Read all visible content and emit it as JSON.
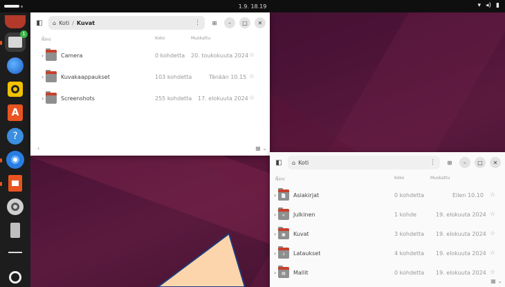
{
  "topbar": {
    "clock": "1.9. 18.19",
    "tray_icons": [
      "network-icon",
      "volume-icon",
      "battery-icon"
    ]
  },
  "dock": {
    "items": [
      {
        "name": "app-center-top",
        "running": false
      },
      {
        "name": "files",
        "running": true,
        "badge": "1"
      },
      {
        "name": "thunderbird",
        "running": false
      },
      {
        "name": "rhythmbox",
        "running": false
      },
      {
        "name": "app-center",
        "running": false
      },
      {
        "name": "help",
        "running": false
      },
      {
        "name": "chromium",
        "running": true
      },
      {
        "name": "presentation",
        "running": true
      },
      {
        "name": "settings",
        "running": false
      },
      {
        "name": "usb-drive",
        "running": false
      },
      {
        "name": "trash",
        "running": false
      },
      {
        "name": "show-apps",
        "running": false
      }
    ]
  },
  "window1": {
    "path_home": "Koti",
    "path_current": "Kuvat",
    "columns": {
      "name": "Nimi",
      "size": "Koko",
      "modified": "Muokattu"
    },
    "rows": [
      {
        "name": "Camera",
        "size": "0 kohdetta",
        "modified": "20. toukokuuta 2024"
      },
      {
        "name": "Kuvakaappaukset",
        "size": "103 kohdetta",
        "modified": "Tänään 10.15"
      },
      {
        "name": "Screenshots",
        "size": "255 kohdetta",
        "modified": "17. elokuuta 2024"
      }
    ]
  },
  "window2": {
    "path_home": "Koti",
    "columns": {
      "name": "Nimi",
      "size": "Koko",
      "modified": "Muokattu"
    },
    "rows": [
      {
        "name": "Asiakirjat",
        "size": "0 kohdetta",
        "modified": "Eilen 10.10",
        "emblem": "📄"
      },
      {
        "name": "Julkinen",
        "size": "1 kohde",
        "modified": "19. elokuuta 2024",
        "emblem": "<"
      },
      {
        "name": "Kuvat",
        "size": "3 kohdetta",
        "modified": "19. elokuuta 2024",
        "emblem": "▣"
      },
      {
        "name": "Lataukset",
        "size": "4 kohdetta",
        "modified": "19. elokuuta 2024",
        "emblem": "↓"
      },
      {
        "name": "Mallit",
        "size": "0 kohdetta",
        "modified": "19. elokuuta 2024",
        "emblem": "▤"
      }
    ]
  },
  "colors": {
    "accent": "#e95420",
    "folder_tab": "#c8402c",
    "dock_bg": "#1d1d1d",
    "topbar_bg": "#0f0f0f",
    "pointer_fill": "#fdd5ac"
  }
}
